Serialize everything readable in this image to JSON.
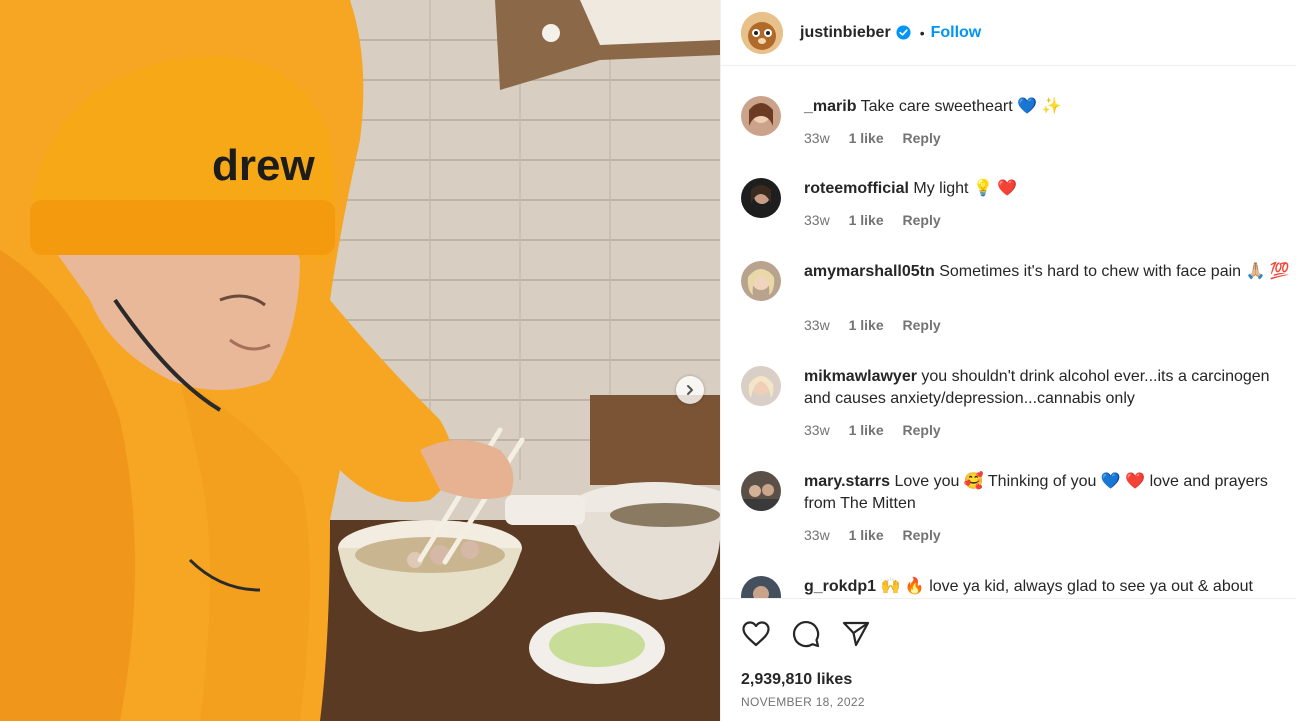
{
  "post": {
    "image": {
      "hat_text": "drew"
    },
    "author": {
      "username": "justinbieber",
      "separator": "•",
      "follow_label": "Follow"
    },
    "comments": [
      {
        "username": "_marib",
        "text": "Take care sweetheart 💙 ✨",
        "time": "33w",
        "likes": "1 like",
        "reply": "Reply"
      },
      {
        "username": "roteemofficial",
        "text": "My light 💡 ❤️",
        "time": "33w",
        "likes": "1 like",
        "reply": "Reply"
      },
      {
        "username": "amymarshall05tn",
        "text": "Sometimes it's hard to chew with face pain 🙏🏼 💯",
        "time": "33w",
        "likes": "1 like",
        "reply": "Reply"
      },
      {
        "username": "mikmawlawyer",
        "text": "you shouldn't drink alcohol ever...its a carcinogen and causes anxiety/depression...cannabis only",
        "time": "33w",
        "likes": "1 like",
        "reply": "Reply"
      },
      {
        "username": "mary.starrs",
        "text": "Love you 🥰 Thinking of you 💙 ❤️ love and prayers from The Mitten",
        "time": "33w",
        "likes": "1 like",
        "reply": "Reply"
      },
      {
        "username": "g_rokdp1",
        "text": "🙌 🔥 love ya kid, always glad to see ya out & about",
        "time": "",
        "likes": "",
        "reply": ""
      }
    ],
    "likes_count": "2,939,810 likes",
    "date": "NOVEMBER 18, 2022"
  },
  "colors": {
    "link_blue": "#0095f6",
    "secondary_text": "#737373",
    "hoodie_orange": "#f6a623"
  },
  "icons": {
    "verified": "verified-badge-icon",
    "next": "chevron-right-icon",
    "like": "heart-icon",
    "comment": "comment-bubble-icon",
    "share": "paper-plane-icon"
  }
}
